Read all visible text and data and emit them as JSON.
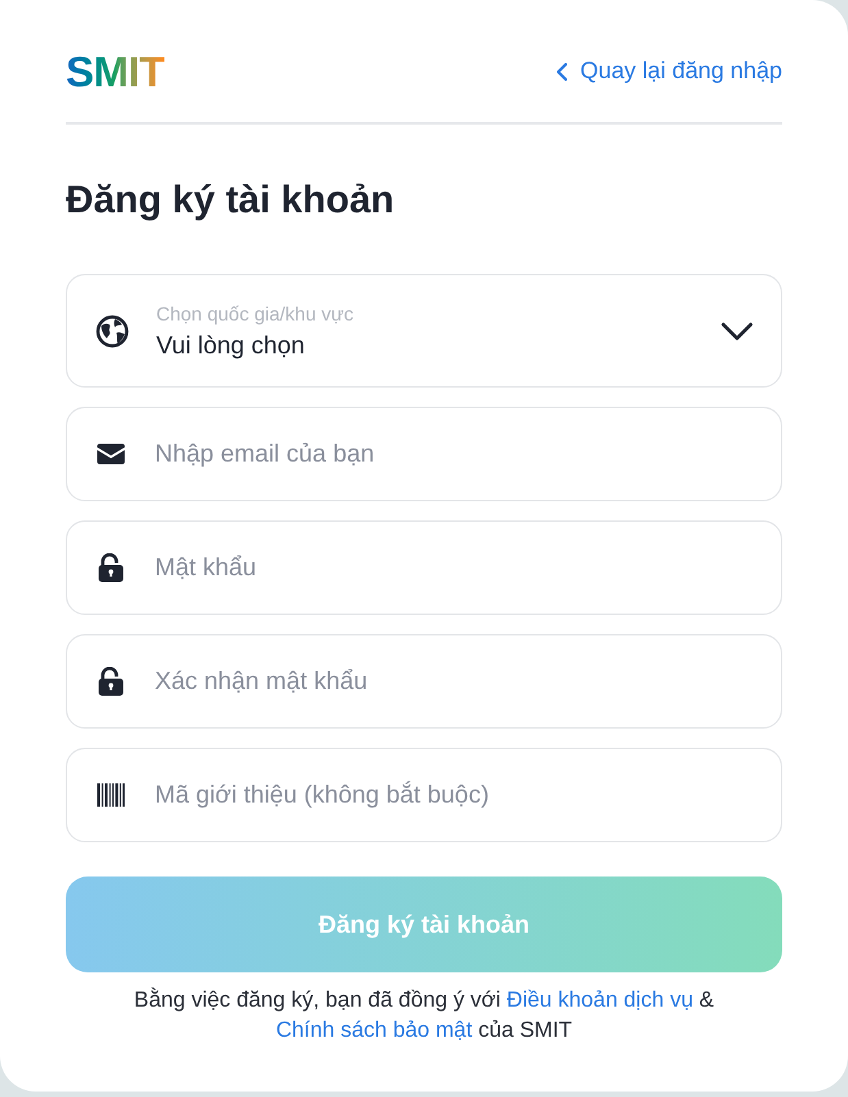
{
  "header": {
    "logo": "SMIT",
    "back_link": "Quay lại đăng nhập"
  },
  "title": "Đăng ký tài khoản",
  "fields": [
    {
      "kind": "select",
      "label": "Chọn quốc gia/khu vực",
      "value": "Vui lòng chọn"
    },
    {
      "kind": "email",
      "placeholder": "Nhập email của bạn"
    },
    {
      "kind": "password",
      "placeholder": "Mật khẩu"
    },
    {
      "kind": "password",
      "placeholder": "Xác nhận mật khẩu"
    },
    {
      "kind": "referral",
      "placeholder": "Mã giới thiệu (không bắt buộc)"
    }
  ],
  "submit": {
    "label": "Đăng ký tài khoản",
    "disabled": true
  },
  "terms": {
    "lines": [
      [
        {
          "kind": "text",
          "text": "Bằng việc đăng ký, bạn đã đồng ý với "
        },
        {
          "kind": "link",
          "text": "Điều khoản dịch vụ"
        },
        {
          "kind": "text",
          "text": " &"
        }
      ],
      [
        {
          "kind": "link",
          "text": "Chính sách bảo mật"
        },
        {
          "kind": "text",
          "text": " của SMIT"
        }
      ]
    ]
  }
}
